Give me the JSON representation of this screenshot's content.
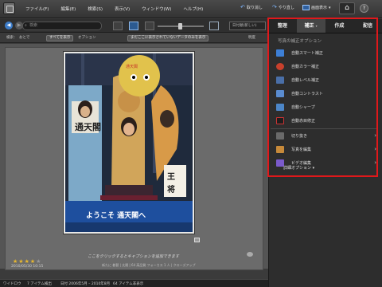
{
  "menubar": {
    "items": [
      "ファイル(F)",
      "編集(E)",
      "検索(S)",
      "表示(V)",
      "ウィンドウ(W)",
      "ヘルプ(H)"
    ],
    "undo_label": "取り消し",
    "redo_label": "やり直し",
    "display_label": "画面表示",
    "home_icon": "house-icon",
    "help_label": "?"
  },
  "navbar": {
    "search_placeholder": "検索",
    "sort_label": "日付順(新しい)"
  },
  "filterbar": {
    "search_label": "検索：",
    "search_value": "おとで",
    "all_button": "すべてを表示",
    "options_label": "オプション",
    "dropdown_button": "まだここに表示されていないデータのみを表示",
    "display_label": "明度"
  },
  "photo": {
    "rating_stars": 4,
    "rating_max": 5,
    "date": "2010/05/30 10:15",
    "caption_hint": "ここをクリックするとキャプションを追加できます",
    "info_line": "新たに 着替 | 太陽 | 64 高品質 フォーカス 1 人 | クローズアップ"
  },
  "status": {
    "left": "ワイドロウ",
    "count": "7 アイテム検出",
    "date_range": "日付 2006年5月 – 2010年8月",
    "shown": "64 アイテム非表示"
  },
  "panel": {
    "tabs": [
      {
        "label": "整理",
        "active": false
      },
      {
        "label": "補正",
        "active": true
      },
      {
        "label": "作成",
        "active": false
      },
      {
        "label": "配信",
        "active": false
      }
    ],
    "heading": "写真の補正オプション",
    "fixes": [
      {
        "label": "自動スマート補正",
        "icon": "smart-fix-icon",
        "color": "#3d7fd6",
        "arrow": false
      },
      {
        "label": "自動カラー補正",
        "icon": "color-fix-icon",
        "color": "#c8402c",
        "arrow": false
      },
      {
        "label": "自動レベル補正",
        "icon": "levels-icon",
        "color": "#4a6fa8",
        "arrow": false
      },
      {
        "label": "自動コントラスト",
        "icon": "contrast-icon",
        "color": "#5a8cd0",
        "arrow": false
      },
      {
        "label": "自動シャープ",
        "icon": "sharpen-icon",
        "color": "#4c86c8",
        "arrow": false
      },
      {
        "label": "自動赤目修正",
        "icon": "red-eye-icon",
        "color": "#1e1e1e",
        "arrow": false
      },
      {
        "label": "切り抜き",
        "icon": "crop-icon",
        "color": "#6a6a6a",
        "arrow": true
      },
      {
        "label": "写真を編集",
        "icon": "edit-photo-icon",
        "color": "#c78a3a",
        "arrow": true
      },
      {
        "label": "ビデオ編集",
        "icon": "video-edit-icon",
        "color": "#7a5acb",
        "arrow": true
      }
    ],
    "advanced_options": "詳細オプション"
  }
}
